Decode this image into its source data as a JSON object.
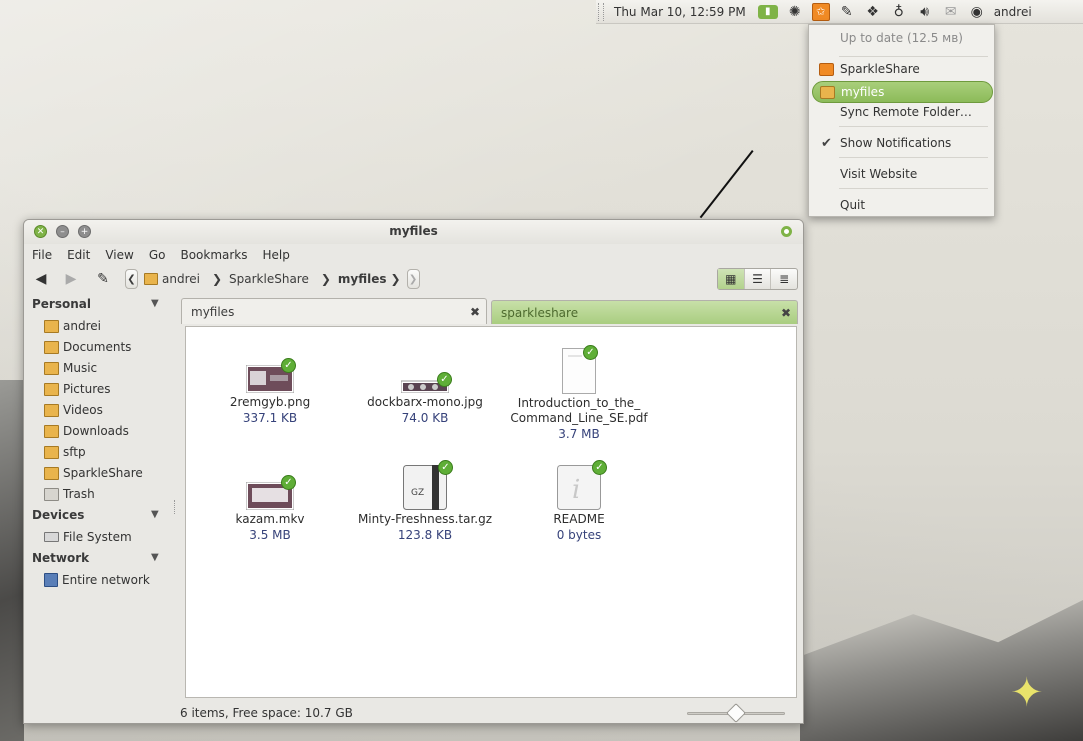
{
  "panel": {
    "clock": "Thu Mar 10, 12:59 PM",
    "user": "andrei",
    "tray_icons": [
      "battery-icon",
      "sync-icon",
      "sparkleshare-icon",
      "pen-icon",
      "dropbox-icon",
      "lightbulb-icon",
      "volume-icon",
      "mail-icon",
      "chat-icon"
    ]
  },
  "tray_menu": {
    "status": "Up to date  (12.5 мв)",
    "items": [
      {
        "label": "SparkleShare",
        "icon": "sparkleshare-icon"
      },
      {
        "label": "myfiles",
        "icon": "folder-icon",
        "selected": true
      },
      {
        "label": "Sync Remote Folder…"
      },
      {
        "label": "Show Notifications",
        "checked": true
      },
      {
        "label": "Visit Website"
      },
      {
        "label": "Quit"
      }
    ]
  },
  "window": {
    "title": "myfiles",
    "menubar": [
      "File",
      "Edit",
      "View",
      "Go",
      "Bookmarks",
      "Help"
    ],
    "breadcrumbs": [
      "andrei",
      "SparkleShare",
      "myfiles"
    ],
    "sidebar": {
      "sections": [
        {
          "title": "Personal",
          "items": [
            "andrei",
            "Documents",
            "Music",
            "Pictures",
            "Videos",
            "Downloads",
            "sftp",
            "SparkleShare",
            "Trash"
          ]
        },
        {
          "title": "Devices",
          "items": [
            "File System"
          ]
        },
        {
          "title": "Network",
          "items": [
            "Entire network"
          ]
        }
      ]
    },
    "tabs": [
      "myfiles",
      "sparkleshare"
    ],
    "files": [
      {
        "name": "2remgyb.png",
        "size": "337.1 KB",
        "type": "image"
      },
      {
        "name": "dockbarx-mono.jpg",
        "size": "74.0 KB",
        "type": "image-wide"
      },
      {
        "name_line1": "Introduction_to_the_",
        "name_line2": "Command_Line_SE.pdf",
        "size": "3.7 MB",
        "type": "pdf"
      },
      {
        "name": "kazam.mkv",
        "size": "3.5 MB",
        "type": "video"
      },
      {
        "name": "Minty-Freshness.tar.gz",
        "size": "123.8 KB",
        "type": "archive",
        "icon_label": "GZ"
      },
      {
        "name": "README",
        "size": "0 bytes",
        "type": "text",
        "icon_label": "i"
      }
    ],
    "status": "6 items, Free space: 10.7 GB",
    "zoom_level": 0.5
  }
}
